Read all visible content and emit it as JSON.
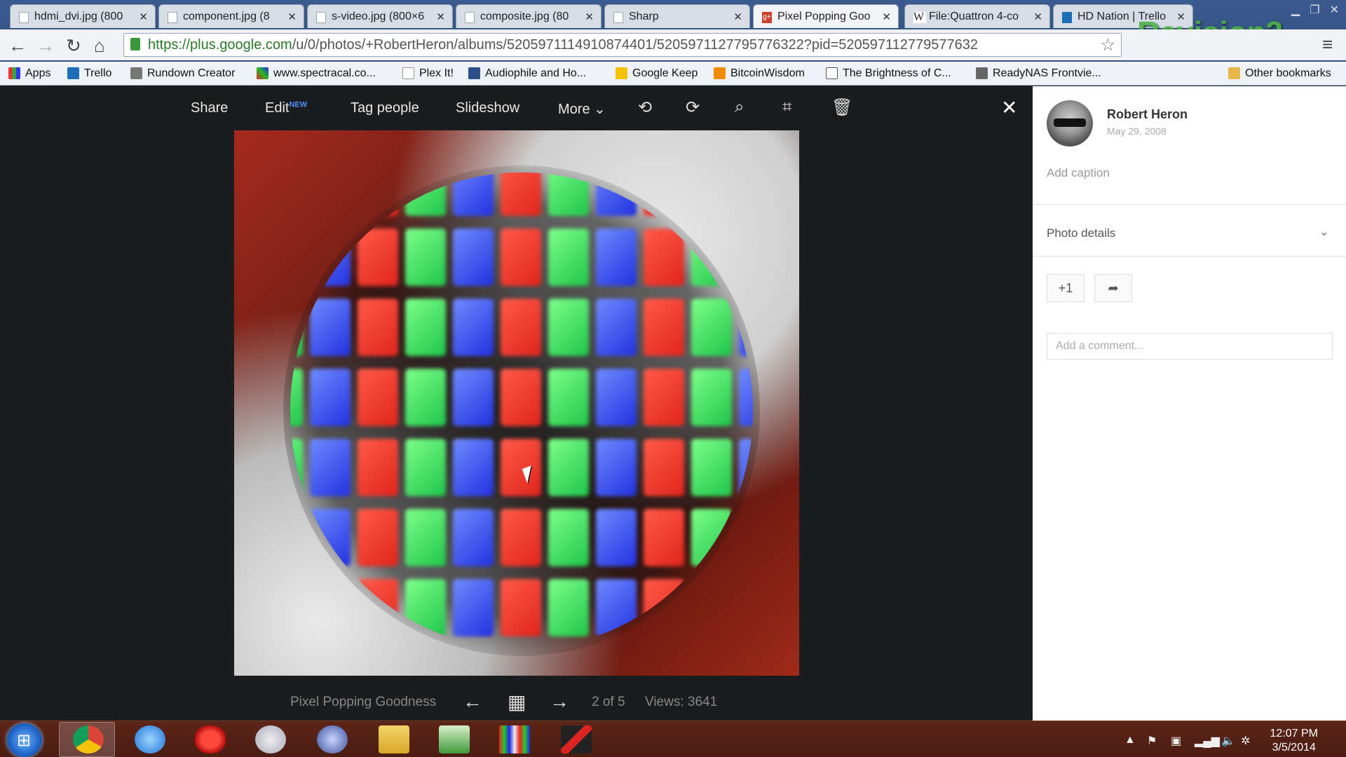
{
  "browser": {
    "tabs": [
      {
        "label": "hdmi_dvi.jpg (800",
        "icon": "page-icon"
      },
      {
        "label": "component.jpg (8",
        "icon": "page-icon"
      },
      {
        "label": "s-video.jpg (800×6",
        "icon": "page-icon"
      },
      {
        "label": "composite.jpg (80",
        "icon": "page-icon"
      },
      {
        "label": "Sharp",
        "icon": "page-icon"
      },
      {
        "label": "Pixel Popping Goo",
        "icon": "google-plus-icon"
      },
      {
        "label": "File:Quattron 4-co",
        "icon": "wikipedia-icon"
      },
      {
        "label": "HD Nation | Trello",
        "icon": "trello-icon"
      }
    ],
    "url_host": "https://plus.google.com",
    "url_path": "/u/0/photos/+RobertHeron/albums/5205971114910874401/5205971127795776322?pid=520597112779577632",
    "bookmarks": [
      {
        "label": "Apps"
      },
      {
        "label": "Trello"
      },
      {
        "label": "Rundown Creator"
      },
      {
        "label": "www.spectracal.co..."
      },
      {
        "label": "Plex It!"
      },
      {
        "label": "Audiophile and Ho..."
      },
      {
        "label": "Google Keep"
      },
      {
        "label": "BitcoinWisdom"
      },
      {
        "label": "The Brightness of C..."
      },
      {
        "label": "ReadyNAS Frontvie..."
      }
    ],
    "other_bookmarks": "Other bookmarks",
    "watermark": "Revision3"
  },
  "viewer": {
    "toolbar": {
      "share": "Share",
      "edit": "Edit",
      "edit_badge": "NEW",
      "tag_people": "Tag people",
      "slideshow": "Slideshow",
      "more": "More"
    },
    "album_title": "Pixel Popping Goodness",
    "position": "2 of 5",
    "views": "Views: 3641"
  },
  "sidebar": {
    "author": "Robert Heron",
    "date": "May 29, 2008",
    "caption_placeholder": "Add caption",
    "photo_details": "Photo details",
    "plus_one": "+1",
    "comment_placeholder": "Add a comment..."
  },
  "taskbar": {
    "time": "12:07 PM",
    "date": "3/5/2014"
  },
  "colors": {
    "accent_blue": "#4d90fe",
    "taskbar": "#4a1d13",
    "viewer_bg": "#1a1c1e"
  }
}
